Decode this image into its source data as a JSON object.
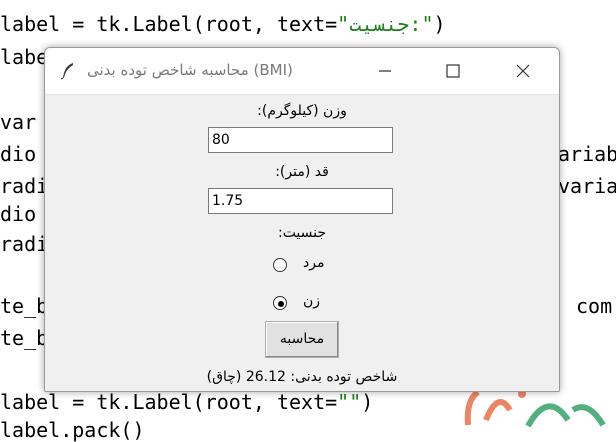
{
  "editor": {
    "lines": [
      {
        "pre": "label = tk.Label(root, text=",
        "str": "\"جنسیت:\"",
        "post": ")"
      },
      {
        "pre": "label",
        "str": "",
        "post": ""
      },
      {
        "pre": "",
        "str": "",
        "post": ""
      },
      {
        "pre": "var",
        "str": "",
        "post": ""
      },
      {
        "pre": "dio",
        "str": "",
        "post": ""
      },
      {
        "pre": "radi",
        "str": "",
        "post": ""
      },
      {
        "pre": "dio",
        "str": "",
        "post": ""
      },
      {
        "pre": "radi",
        "str": "",
        "post": ""
      },
      {
        "pre": "",
        "str": "",
        "post": ""
      },
      {
        "pre": "te_b",
        "str": "",
        "post": ""
      },
      {
        "pre": "te_b",
        "str": "",
        "post": ""
      },
      {
        "pre": "",
        "str": "",
        "post": ""
      },
      {
        "pre": "label = tk.Label(root, text=",
        "str": "\"\"",
        "post": ")"
      },
      {
        "pre": "label.pack()",
        "str": "",
        "post": ""
      }
    ],
    "right_fragments": [
      "ariab",
      "varia",
      "com"
    ]
  },
  "window": {
    "title": "محاسبه شاخص توده بدنی (BMI)",
    "weight_label": ":وزن (کیلوگرم)",
    "weight_value": "80",
    "height_label": ":قد (متر)",
    "height_value": "1.75",
    "gender_label": ":جنسیت",
    "gender_options": [
      {
        "label": "مرد",
        "selected": false
      },
      {
        "label": "زن",
        "selected": true
      }
    ],
    "calculate_label": "محاسبه",
    "result_text": "شاخص توده بدنی: 26.12 (چاق)"
  }
}
